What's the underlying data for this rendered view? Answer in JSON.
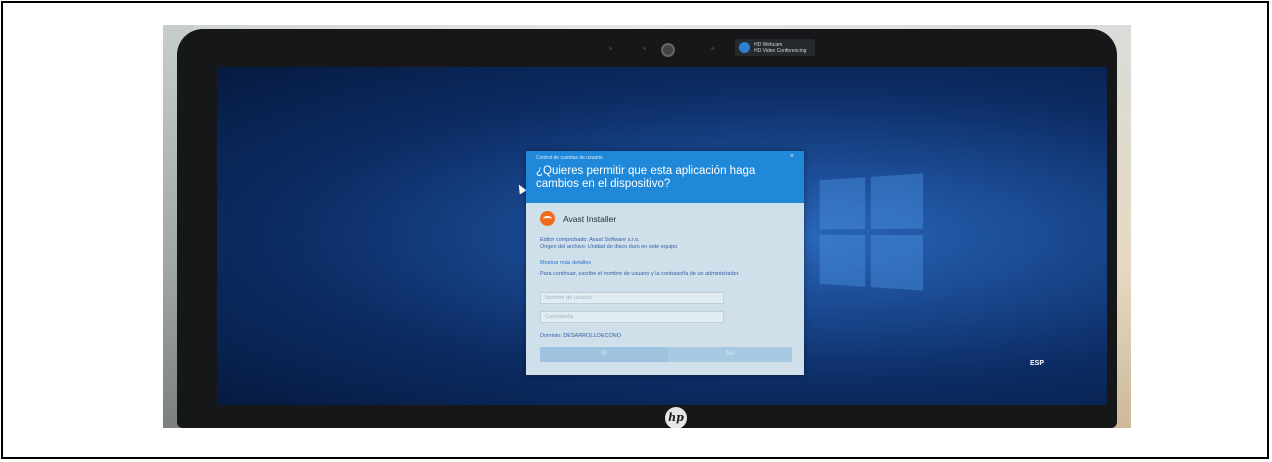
{
  "webcam": {
    "brand": "HD Webcam",
    "subtitle": "HD Video Conferencing"
  },
  "dialog": {
    "caption": "Control de cuentas de usuario",
    "close": "×",
    "question": "¿Quieres permitir que esta aplicación haga cambios en el dispositivo?",
    "app_name": "Avast Installer",
    "publisher": "Editor comprobado: Avast Software s.r.o.",
    "origin": "Origen del archivo: Unidad de disco duro en este equipo",
    "more_details": "Mostrar más detalles",
    "instructions": "Para continuar, escribe el nombre de usuario y la contraseña de un administrador.",
    "username_placeholder": "Nombre de usuario",
    "password_placeholder": "Contraseña",
    "domain": "Dominio: DESARROLLOECONO",
    "yes_label": "Sí",
    "no_label": "No"
  },
  "taskbar": {
    "language": "ESP"
  },
  "laptop": {
    "logo": "hp"
  },
  "colors": {
    "dialog_header": "#1f88d8",
    "dialog_body": "#cfe0ea",
    "desktop": "#0d2d66",
    "avast": "#f26b1d"
  }
}
